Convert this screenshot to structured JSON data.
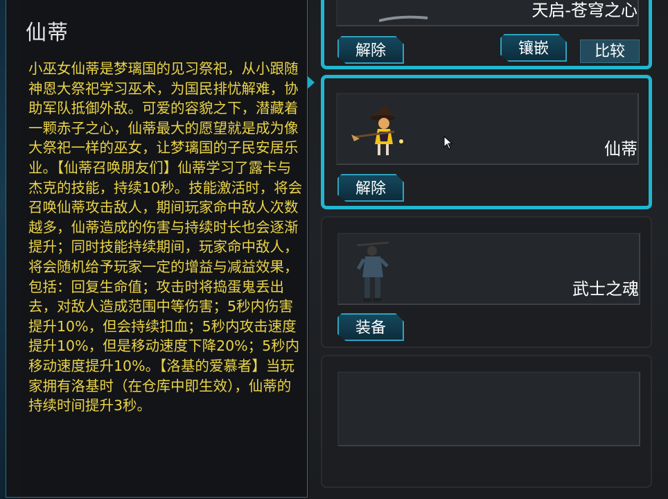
{
  "tooltip": {
    "title": "仙蒂",
    "description": "小巫女仙蒂是梦璃国的见习祭祀，从小跟随神恩大祭祀学习巫术，为国民排忧解难，协助军队抵御外敌。可爱的容貌之下，潜藏着一颗赤子之心，仙蒂最大的愿望就是成为像大祭祀一样的巫女，让梦璃国的子民安居乐业。【仙蒂召唤朋友们】仙蒂学习了露卡与杰克的技能，持续10秒。技能激活时，将会召唤仙蒂攻击敌人，期间玩家命中敌人次数越多，仙蒂造成的伤害与持续时长也会逐渐提升；同时技能持续期间，玩家命中敌人，将会随机给予玩家一定的增益与减益效果，包括：回复生命值；攻击时将捣蛋鬼丢出去，对敌人造成范围中等伤害；5秒内伤害提升10%，但会持续扣血；5秒内攻击速度提升10%，但是移动速度下降20%；5秒内移动速度提升10%。【洛基的爱慕者】当玩家拥有洛基时（在仓库中即生效），仙蒂的持续时间提升3秒。"
  },
  "slots": [
    {
      "name": "天启-苍穹之心",
      "buttons": {
        "remove": "解除",
        "inlay": "镶嵌",
        "compare": "比较"
      }
    },
    {
      "name": "仙蒂",
      "buttons": {
        "remove": "解除"
      }
    },
    {
      "name": "武士之魂",
      "buttons": {
        "equip": "装备"
      }
    },
    {
      "name": ""
    }
  ],
  "colors": {
    "accent": "#1fb7d1",
    "description_text": "#e9d34a"
  }
}
